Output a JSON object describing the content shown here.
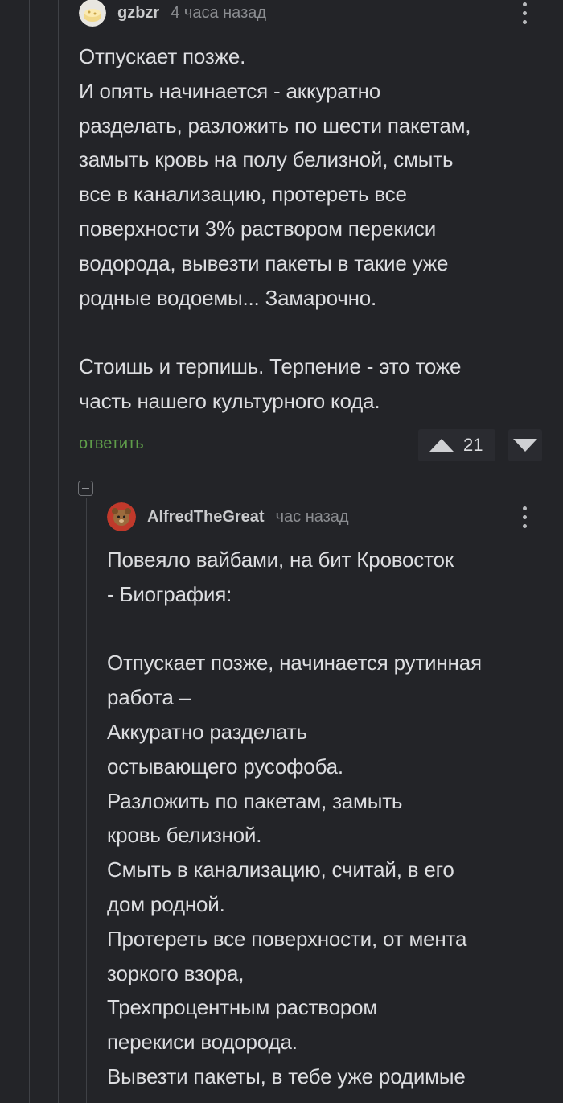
{
  "comment1": {
    "username": "gzbzr",
    "time": "4 часа назад",
    "paragraphs": [
      "Отпускает позже.",
      "И опять начинается - аккуратно",
      "разделать, разложить по шести пакетам,",
      "замыть кровь на полу белизной, смыть",
      "все в канализацию, протереть все",
      "поверхности 3% раствором перекиси",
      "водорода, вывезти пакеты в такие уже",
      "родные водоемы... Замарочно.",
      "",
      "Стоишь и терпишь. Терпение - это тоже",
      "часть нашего культурного кода."
    ],
    "reply_label": "ответить",
    "rating": "21"
  },
  "comment2": {
    "username": "AlfredTheGreat",
    "time": "час назад",
    "lines": [
      "Повеяло вайбами, на бит Кровосток",
      "- Биография:",
      "",
      "Отпускает позже, начинается рутинная",
      "работа –",
      "Аккуратно разделать",
      "остывающего русофоба.",
      "Разложить по пакетам, замыть",
      "кровь белизной.",
      "Смыть в канализацию, считай, в его",
      "дом родной.",
      "Протереть все поверхности, от мента",
      "зоркого взора,",
      "Трехпроцентным раствором",
      "перекиси водорода.",
      "Вывезти пакеты, в тебе уже родимые"
    ]
  },
  "icons": {
    "more": "more-vertical-icon",
    "upvote": "arrow-up-icon",
    "downvote": "arrow-down-icon",
    "collapse": "minus-square-icon"
  },
  "colors": {
    "background": "#232428",
    "text": "#dcdde0",
    "meta": "#8b8d91",
    "reply_link": "#5f9d4a",
    "vote_bg": "#2a2b30"
  }
}
